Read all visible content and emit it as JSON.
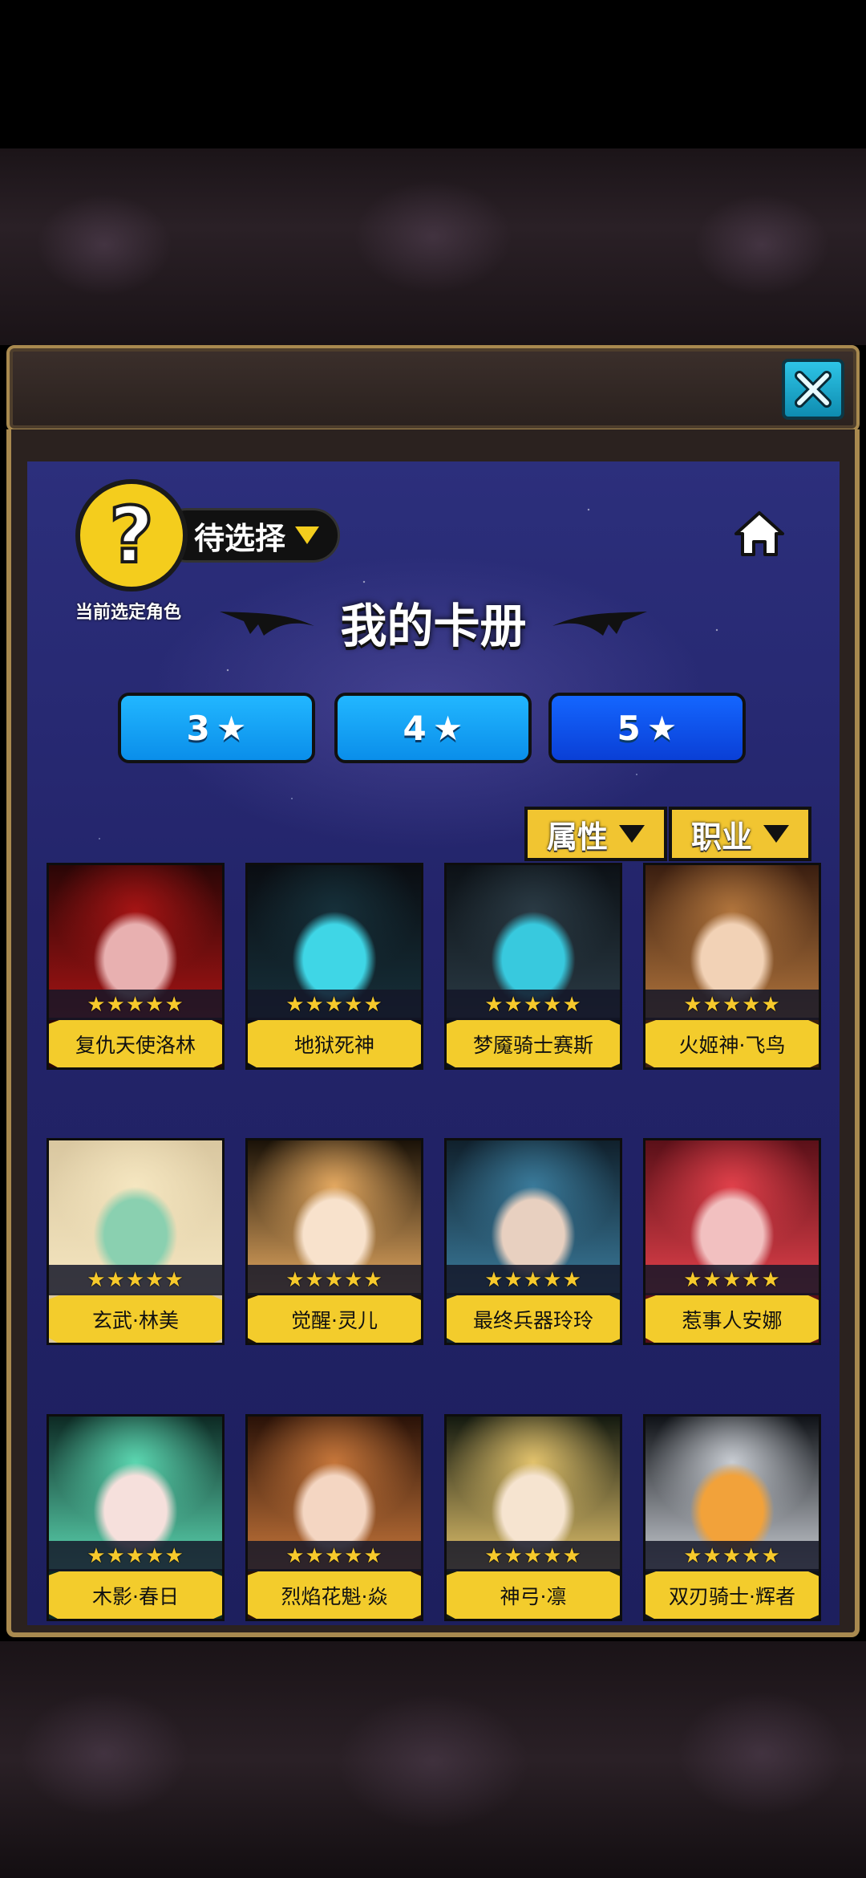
{
  "current_selection": {
    "badge_symbol": "?",
    "dropdown_label": "待选择",
    "caption": "当前选定角色"
  },
  "album_title": "我的卡册",
  "star_tabs": [
    {
      "label": "3",
      "active": false
    },
    {
      "label": "4",
      "active": false
    },
    {
      "label": "5",
      "active": true
    }
  ],
  "filters": {
    "attribute_label": "属性",
    "class_label": "职业"
  },
  "star_rating_display": "★★★★★",
  "cards": [
    {
      "name": "复仇天使洛林",
      "stars": 5,
      "palette": [
        "#2a0606",
        "#a51414",
        "#e8b0b0"
      ]
    },
    {
      "name": "地狱死神",
      "stars": 5,
      "palette": [
        "#0a0d12",
        "#16303a",
        "#3fd6e6"
      ]
    },
    {
      "name": "梦魇骑士赛斯",
      "stars": 5,
      "palette": [
        "#0c1116",
        "#2a3a44",
        "#38c9de"
      ]
    },
    {
      "name": "火姬神·飞鸟",
      "stars": 5,
      "palette": [
        "#3a1e10",
        "#b0743c",
        "#f2d2b6"
      ]
    },
    {
      "name": "玄武·林美",
      "stars": 5,
      "palette": [
        "#d9c7a0",
        "#f5e6c0",
        "#8ad0b0"
      ]
    },
    {
      "name": "觉醒·灵儿",
      "stars": 5,
      "palette": [
        "#1a1208",
        "#e3a860",
        "#f8e2cc"
      ]
    },
    {
      "name": "最终兵器玲玲",
      "stars": 5,
      "palette": [
        "#10202c",
        "#3a7a9a",
        "#e8d0c0"
      ]
    },
    {
      "name": "惹事人安娜",
      "stars": 5,
      "palette": [
        "#5a1018",
        "#e0404a",
        "#f2c0c0"
      ]
    },
    {
      "name": "木影·春日",
      "stars": 5,
      "palette": [
        "#0d2a24",
        "#5bd6b0",
        "#f6e0dc"
      ]
    },
    {
      "name": "烈焰花魁·焱",
      "stars": 5,
      "palette": [
        "#2a1208",
        "#c6763a",
        "#f4d6c2"
      ]
    },
    {
      "name": "神弓·凛",
      "stars": 5,
      "palette": [
        "#141a10",
        "#e2c26c",
        "#f6e4d0"
      ]
    },
    {
      "name": "双刃骑士·辉者",
      "stars": 5,
      "palette": [
        "#101318",
        "#c8ccd2",
        "#f2a23a"
      ]
    }
  ]
}
